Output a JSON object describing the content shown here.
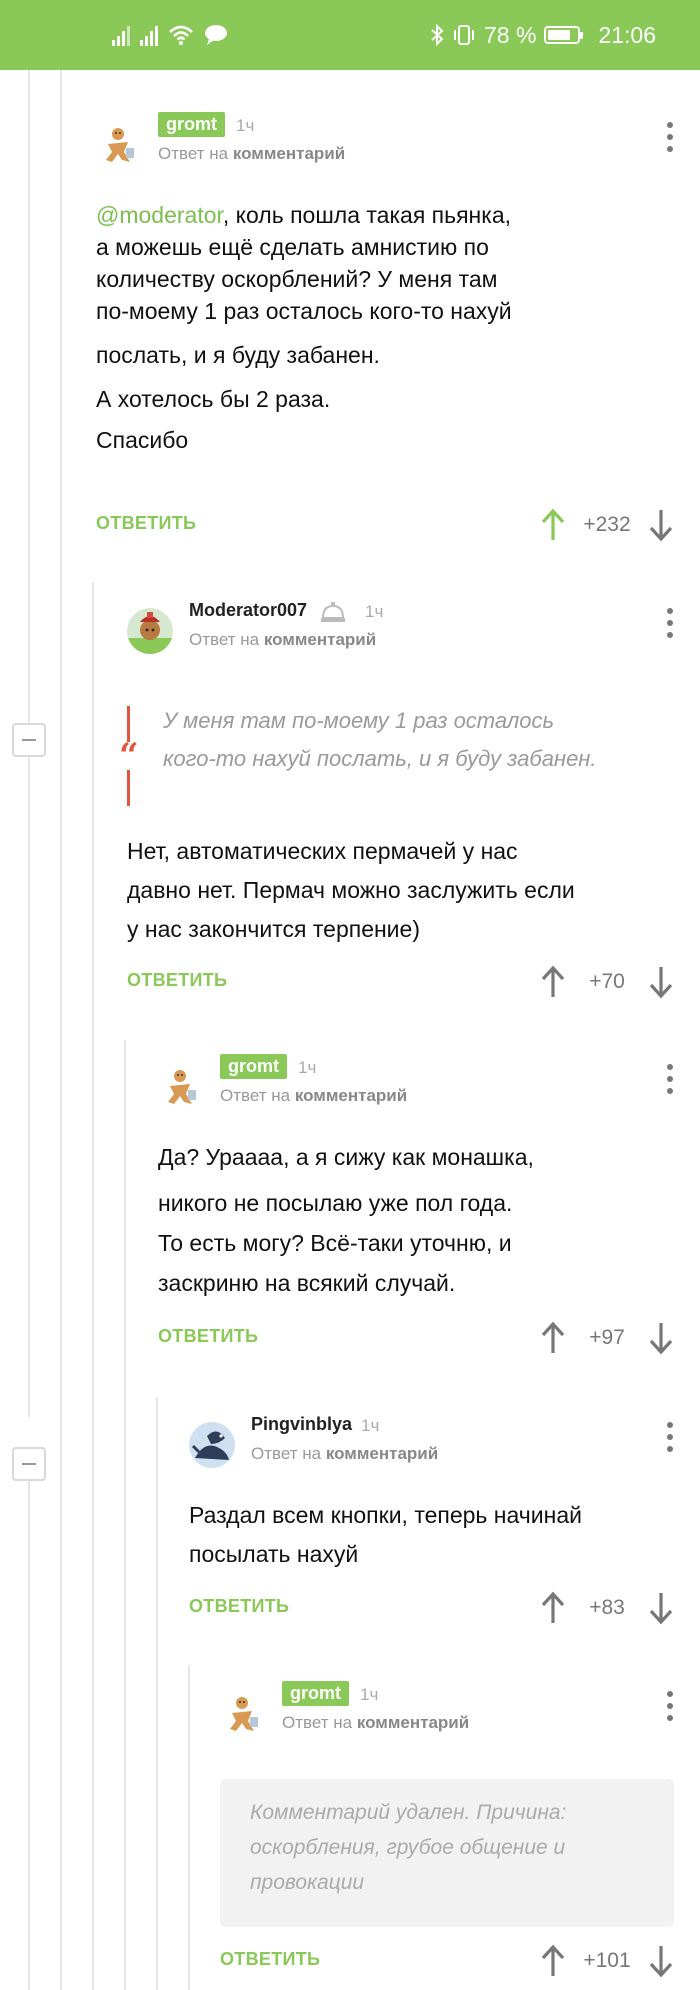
{
  "status_bar": {
    "battery": "78 %",
    "time": "21:06",
    "icons": [
      "signal-icon",
      "signal-icon",
      "wifi-icon",
      "message-icon",
      "bluetooth-icon",
      "vibrate-icon",
      "battery-icon"
    ]
  },
  "colors": {
    "accent": "#8ac858",
    "quote": "#e2553f",
    "muted": "#999999"
  },
  "reply_to_prefix": "Ответ на",
  "reply_to_link": "комментарий",
  "reply_label": "ОТВЕТИТЬ",
  "comments": [
    {
      "author": "gromt",
      "time": "1ч",
      "body": [
        "@moderator, коль пошла такая пьянка,",
        "а можешь ещё сделать амнистию по",
        "количеству оскорблений? У меня там",
        "по-моему 1 раз осталось кого-то нахуй",
        "послать, и я буду забанен.",
        "А хотелось бы 2 раза.",
        "Спасибо"
      ],
      "mention": "@moderator",
      "rating": "+232"
    },
    {
      "author": "Moderator007",
      "time": "1ч",
      "quote": [
        "У меня там по-моему 1 раз осталось",
        "кого-то нахуй послать, и я буду забанен."
      ],
      "body": [
        "Нет, автоматических пермачей у нас",
        "давно нет. Пермач можно заслужить если",
        "у нас закончится терпение)"
      ],
      "rating": "+70"
    },
    {
      "author": "gromt",
      "time": "1ч",
      "body": [
        "Да? Ураааа, а я сижу как монашка,",
        "никого не посылаю уже пол года.",
        "То есть могу? Всё-таки уточню, и",
        "заскриню на всякий случай."
      ],
      "rating": "+97"
    },
    {
      "author": "Pingvinblya",
      "time": "1ч",
      "body": [
        "Раздал всем кнопки, теперь начинай",
        "посылать нахуй"
      ],
      "rating": "+83"
    },
    {
      "author": "gromt",
      "time": "1ч",
      "deleted": [
        "Комментарий удален. Причина:",
        "оскорбления, грубое общение и",
        "провокации"
      ],
      "rating": "+101"
    }
  ]
}
